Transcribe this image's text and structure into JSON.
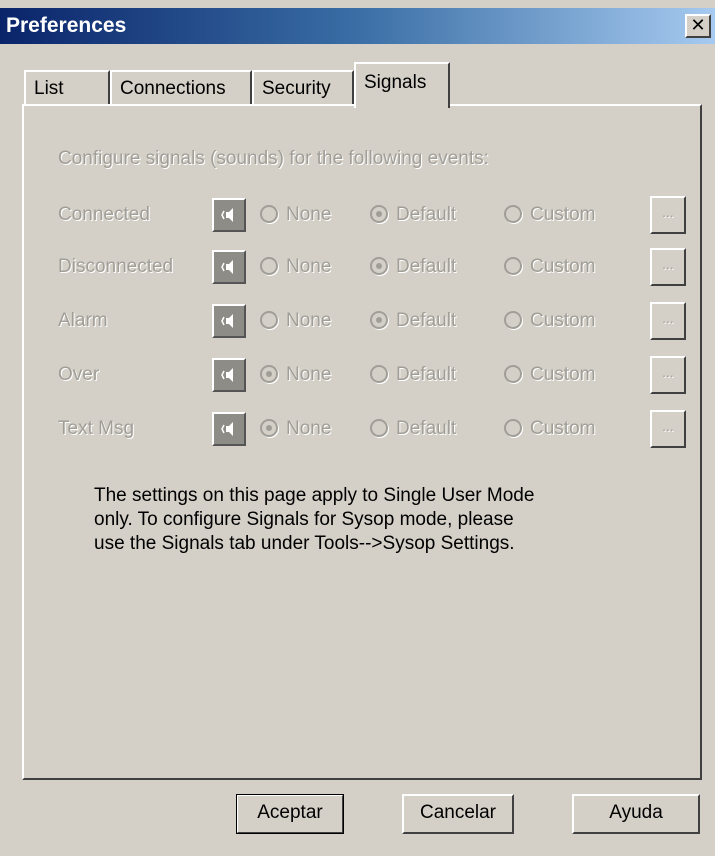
{
  "window": {
    "title": "Preferences",
    "close_glyph": "✕"
  },
  "tabs": [
    {
      "label": "List",
      "active": false
    },
    {
      "label": "Connections",
      "active": false
    },
    {
      "label": "Security",
      "active": false
    },
    {
      "label": "Signals",
      "active": true
    }
  ],
  "signals": {
    "intro": "Configure signals (sounds) for the following events:",
    "option_labels": {
      "none": "None",
      "default": "Default",
      "custom": "Custom"
    },
    "browse_label": "...",
    "events": [
      {
        "label": "Connected",
        "selected": "default"
      },
      {
        "label": "Disconnected",
        "selected": "default"
      },
      {
        "label": "Alarm",
        "selected": "default"
      },
      {
        "label": "Over",
        "selected": "none"
      },
      {
        "label": "Text Msg",
        "selected": "none"
      }
    ],
    "note_lines": [
      "The settings on this page apply to Single User Mode",
      "only.  To configure Signals for Sysop mode, please",
      "use the Signals tab under Tools-->Sysop Settings."
    ],
    "icons": {
      "speaker": "speaker-icon"
    }
  },
  "buttons": {
    "ok": "Aceptar",
    "cancel": "Cancelar",
    "help": "Ayuda"
  },
  "colors": {
    "title_gradient_start": "#0a246a",
    "title_gradient_end": "#a6caf0",
    "face": "#d4d0c8",
    "disabled_text": "#a19e97"
  }
}
